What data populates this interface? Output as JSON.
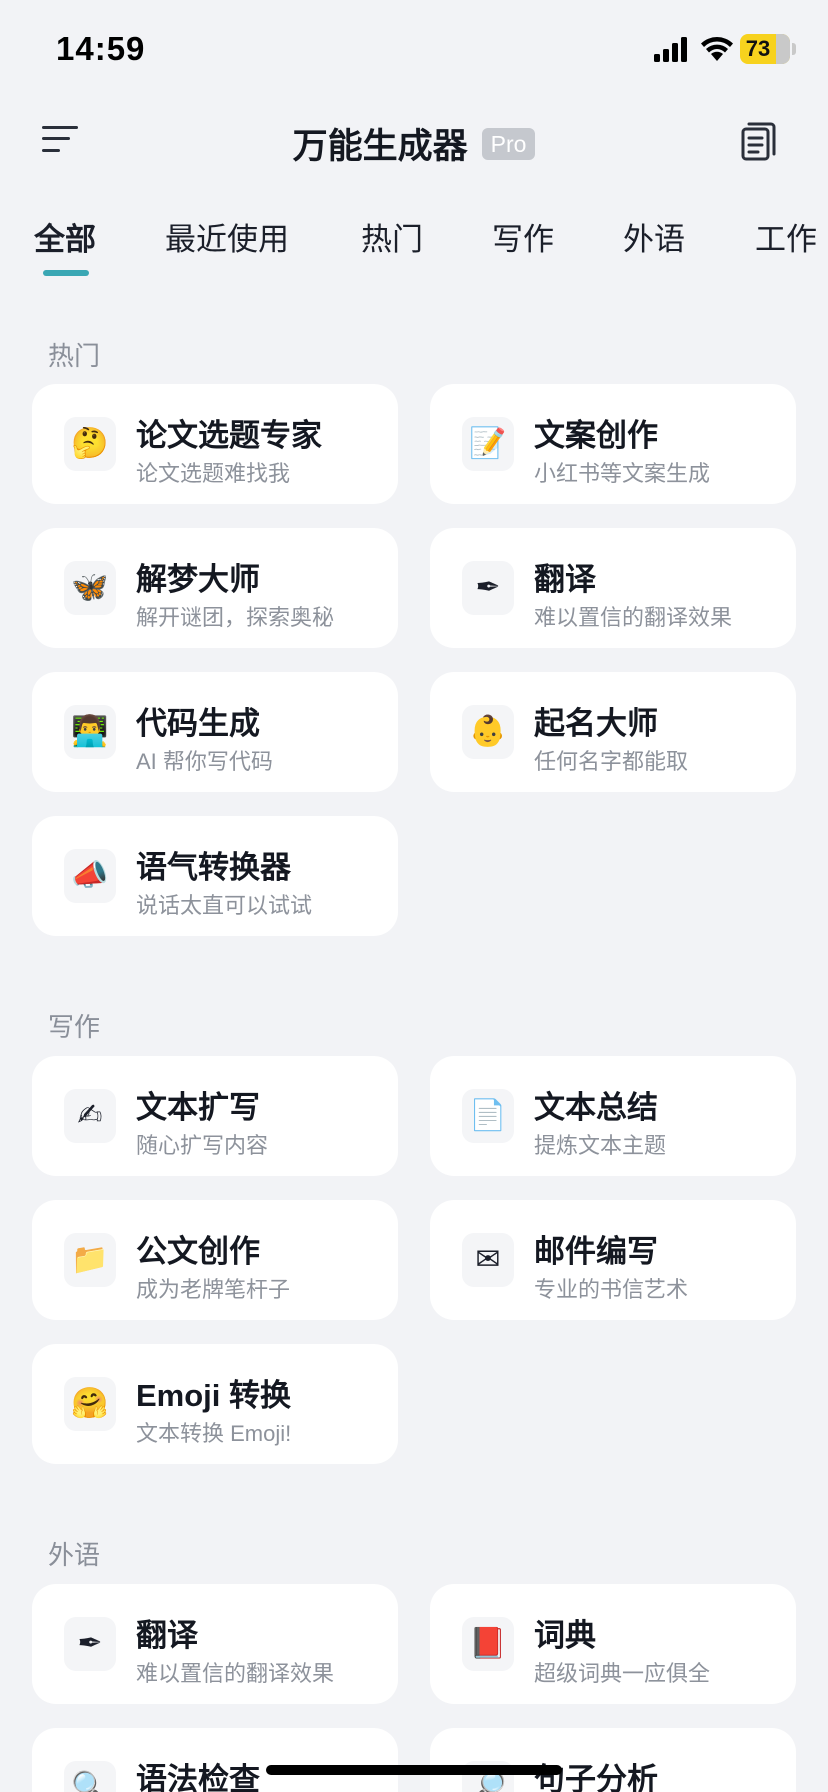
{
  "status_bar": {
    "time": "14:59",
    "battery": "73",
    "icons": [
      "signal-icon",
      "wifi-icon",
      "battery-icon"
    ]
  },
  "header": {
    "title": "万能生成器",
    "badge": "Pro",
    "menu_icon": "menu-icon",
    "history_icon": "history-icon"
  },
  "tabs": [
    {
      "label": "全部",
      "active": true
    },
    {
      "label": "最近使用"
    },
    {
      "label": "热门"
    },
    {
      "label": "写作"
    },
    {
      "label": "外语"
    },
    {
      "label": "工作"
    }
  ],
  "sections": [
    {
      "title": "热门",
      "items": [
        {
          "icon": "thinking-face-icon",
          "glyph": "🤔",
          "name": "论文选题专家",
          "desc": "论文选题难找我"
        },
        {
          "icon": "memo-icon",
          "glyph": "📝",
          "name": "文案创作",
          "desc": "小红书等文案生成"
        },
        {
          "icon": "butterfly-icon",
          "glyph": "🦋",
          "name": "解梦大师",
          "desc": "解开谜团，探索奥秘"
        },
        {
          "icon": "fountain-pen-icon",
          "glyph": "✒",
          "name": "翻译",
          "desc": "难以置信的翻译效果"
        },
        {
          "icon": "technologist-icon",
          "glyph": "👨‍💻",
          "name": "代码生成",
          "desc": "AI 帮你写代码"
        },
        {
          "icon": "baby-icon",
          "glyph": "👶",
          "name": "起名大师",
          "desc": "任何名字都能取"
        },
        {
          "icon": "megaphone-icon",
          "glyph": "📣",
          "name": "语气转换器",
          "desc": "说话太直可以试试"
        }
      ]
    },
    {
      "title": "写作",
      "items": [
        {
          "icon": "writing-hand-icon",
          "glyph": "✍",
          "name": "文本扩写",
          "desc": "随心扩写内容"
        },
        {
          "icon": "document-icon",
          "glyph": "📄",
          "name": "文本总结",
          "desc": "提炼文本主题"
        },
        {
          "icon": "folder-icon",
          "glyph": "📁",
          "name": "公文创作",
          "desc": "成为老牌笔杆子"
        },
        {
          "icon": "envelope-icon",
          "glyph": "✉",
          "name": "邮件编写",
          "desc": "专业的书信艺术"
        },
        {
          "icon": "hugging-face-icon",
          "glyph": "🤗",
          "name": "Emoji 转换",
          "desc": "文本转换 Emoji!"
        }
      ]
    },
    {
      "title": "外语",
      "items": [
        {
          "icon": "fountain-pen-icon",
          "glyph": "✒",
          "name": "翻译",
          "desc": "难以置信的翻译效果"
        },
        {
          "icon": "red-book-icon",
          "glyph": "📕",
          "name": "词典",
          "desc": "超级词典一应俱全"
        },
        {
          "icon": "magnifier-icon",
          "glyph": "🔍",
          "name": "语法检查",
          "desc": ""
        },
        {
          "icon": "magnifier-icon",
          "glyph": "🔎",
          "name": "句子分析",
          "desc": ""
        }
      ]
    }
  ],
  "colors": {
    "background": "#f2f3f6",
    "card": "#ffffff",
    "accent": "#3aa7b4",
    "title": "#141821",
    "subtitle": "#8d929b",
    "battery": "#f7d21e"
  }
}
